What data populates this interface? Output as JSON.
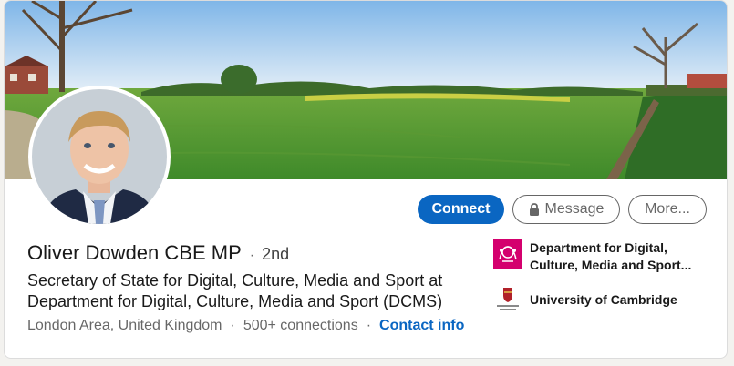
{
  "profile": {
    "name": "Oliver Dowden CBE MP",
    "separator": "·",
    "degree": "2nd",
    "headline": "Secretary of State for Digital, Culture, Media and Sport at Department for Digital, Culture, Media and Sport (DCMS)",
    "location": "London Area, United Kingdom",
    "connections": "500+ connections",
    "contact_info": "Contact info"
  },
  "actions": {
    "connect": "Connect",
    "message": "Message",
    "more": "More..."
  },
  "organizations": [
    {
      "name": "Department for Digital, Culture, Media and Sport...",
      "logo": "dcms-crest-logo"
    },
    {
      "name": "University of Cambridge",
      "logo": "cambridge-crest-logo"
    }
  ],
  "colors": {
    "primary": "#0a66c2",
    "dcms_logo_bg": "#d4006e",
    "cambridge_red": "#b1212a"
  },
  "icons": {
    "message_lock": "lock-icon"
  }
}
